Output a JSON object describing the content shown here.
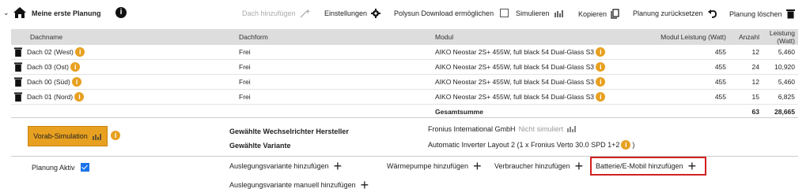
{
  "header": {
    "title": "Meine erste Planung",
    "info_icon": "info-icon",
    "toolbar": {
      "add_roof": "Dach hinzufügen",
      "settings": "Einstellungen",
      "polysun": "Polysun Download ermöglichen",
      "simulate": "Simulieren",
      "copy": "Kopieren",
      "reset": "Planung zurücksetzen",
      "delete": "Planung löschen"
    }
  },
  "table": {
    "headers": {
      "dachname": "Dachname",
      "dachform": "Dachform",
      "modul": "Modul",
      "modul_leistung": "Modul Leistung (Watt)",
      "anzahl": "Anzahl",
      "leistung": "Leistung (Watt)"
    },
    "rows": [
      {
        "name": "Dach 02 (West)",
        "form": "Frei",
        "modul": "AIKO Neostar 2S+ 455W, full black 54 Dual-Glass S3",
        "watt": "455",
        "count": "12",
        "total": "5,460"
      },
      {
        "name": "Dach 03 (Ost)",
        "form": "Frei",
        "modul": "AIKO Neostar 2S+ 455W, full black 54 Dual-Glass S3",
        "watt": "455",
        "count": "24",
        "total": "10,920"
      },
      {
        "name": "Dach 00 (Süd)",
        "form": "Frei",
        "modul": "AIKO Neostar 2S+ 455W, full black 54 Dual-Glass S3",
        "watt": "455",
        "count": "12",
        "total": "5,460"
      },
      {
        "name": "Dach 01 (Nord)",
        "form": "Frei",
        "modul": "AIKO Neostar 2S+ 455W, full black 54 Dual-Glass S3",
        "watt": "455",
        "count": "15",
        "total": "6,825"
      }
    ],
    "sum": {
      "label": "Gesamtsumme",
      "count": "63",
      "total": "28,665"
    }
  },
  "inverter": {
    "vorab_label": "Vorab-Simulation",
    "manufacturer_label": "Gewählte Wechselrichter Hersteller",
    "manufacturer_value": "Fronius International GmbH",
    "not_simulated": "Nicht simuliert",
    "variant_label": "Gewählte Variante",
    "variant_value_pre": "Automatic Inverter Layout 2 (1 x Fronius Verto 30.0 SPD 1+2",
    "variant_value_post": ")"
  },
  "actions": {
    "planning_active": "Planung Aktiv",
    "add_variant": "Auslegungsvariante hinzufügen",
    "add_heatpump": "Wärmepumpe hinzufügen",
    "add_consumer": "Verbraucher hinzufügen",
    "add_battery": "Batterie/E-Mobil hinzufügen",
    "add_variant_manual": "Auslegungsvariante manuell hinzufügen"
  },
  "colors": {
    "accent": "#e8a020",
    "highlight": "#d32020",
    "header_bg": "#dddddd"
  }
}
